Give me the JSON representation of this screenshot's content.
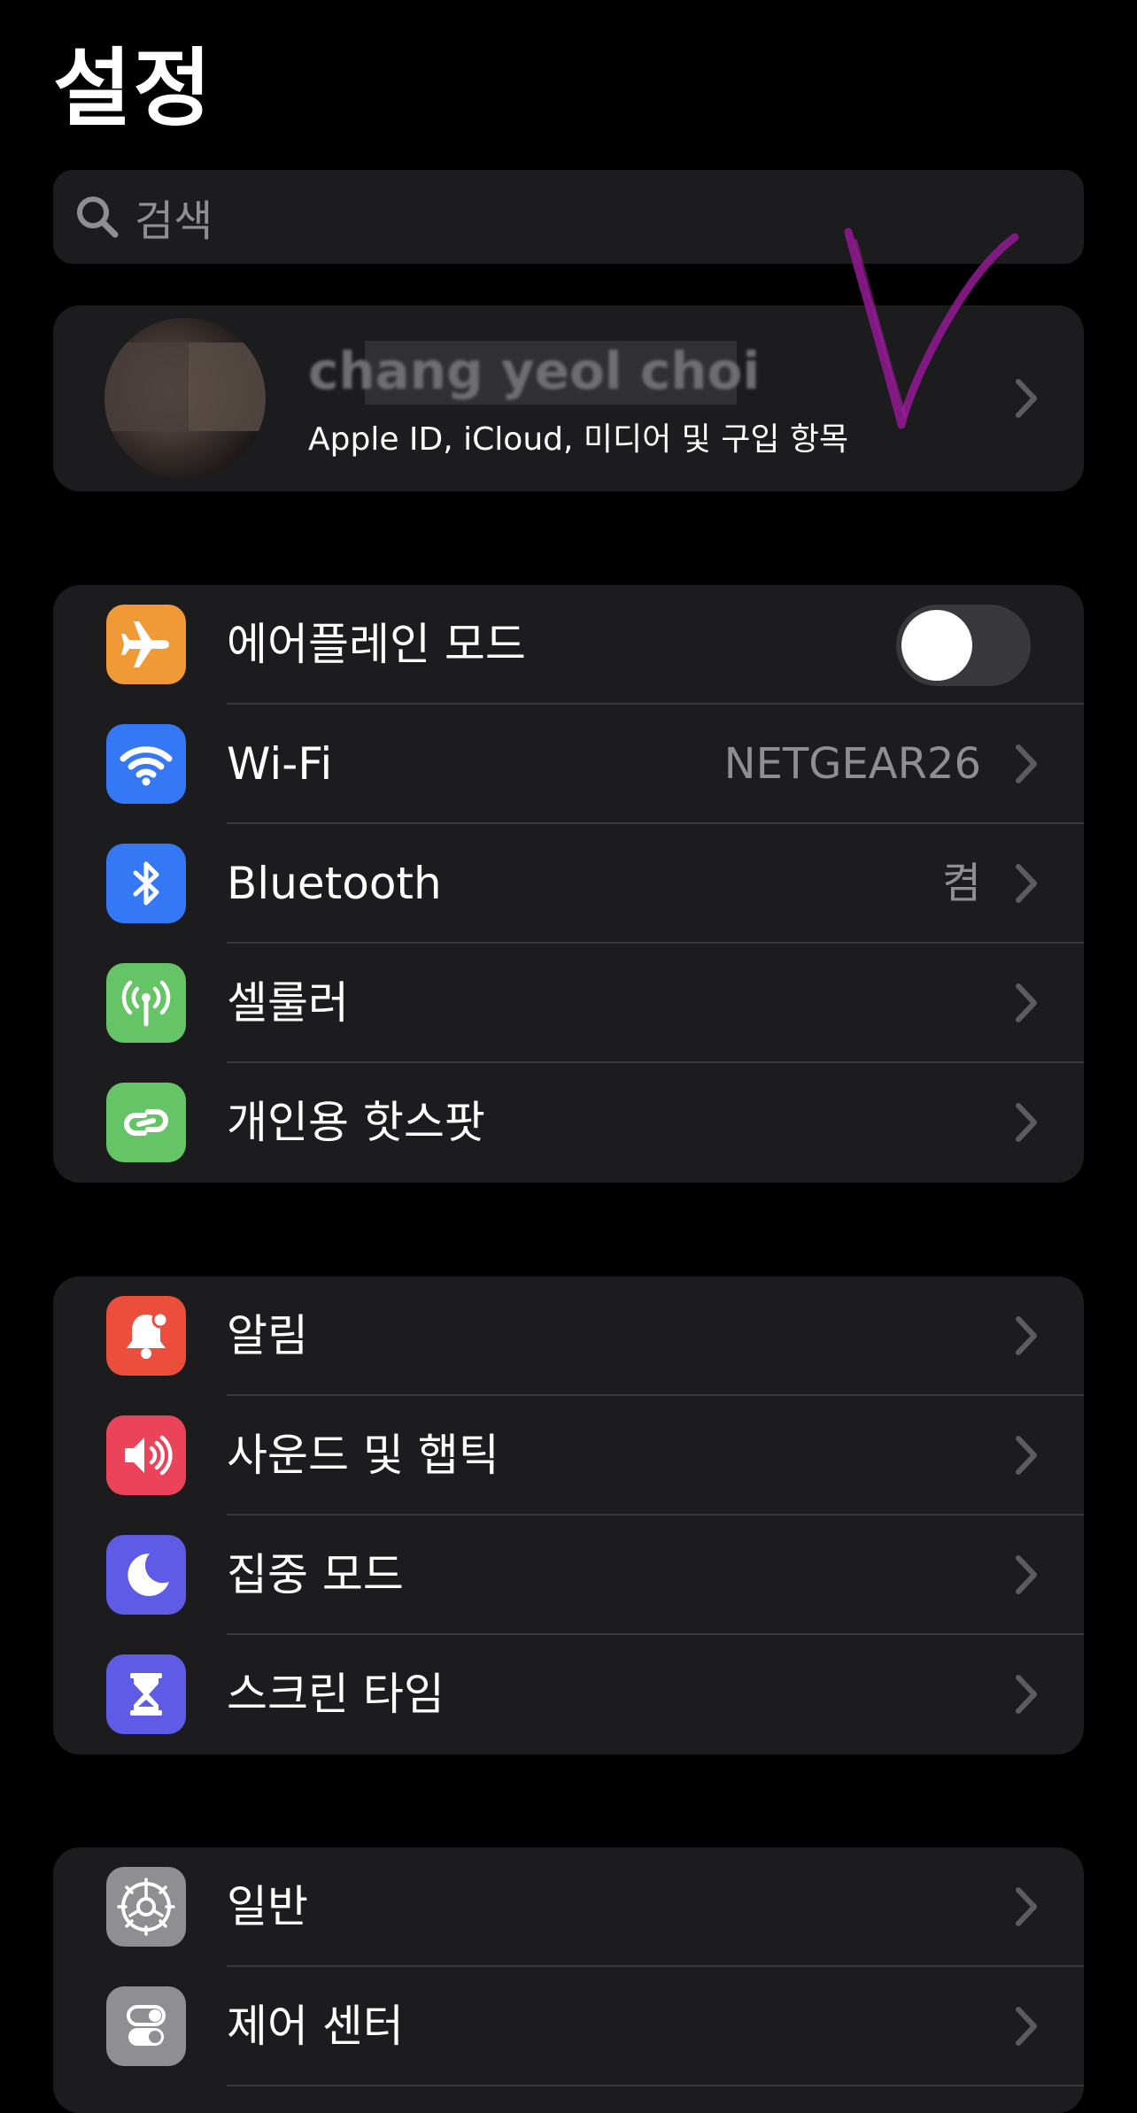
{
  "header": {
    "title": "설정"
  },
  "search": {
    "placeholder": "검색"
  },
  "profile": {
    "name": "chang yeol choi",
    "subtitle": "Apple ID, iCloud, 미디어 및 구입 항목"
  },
  "group1": {
    "items": [
      {
        "label": "에어플레인 모드",
        "icon": "airplane-icon",
        "color": "#f09a37",
        "toggle": false
      },
      {
        "label": "Wi-Fi",
        "icon": "wifi-icon",
        "color": "#3478f6",
        "value": "NETGEAR26"
      },
      {
        "label": "Bluetooth",
        "icon": "bluetooth-icon",
        "color": "#3478f6",
        "value": "켬"
      },
      {
        "label": "셀룰러",
        "icon": "antenna-icon",
        "color": "#65c466"
      },
      {
        "label": "개인용 핫스팟",
        "icon": "hotspot-link-icon",
        "color": "#65c466"
      }
    ]
  },
  "group2": {
    "items": [
      {
        "label": "알림",
        "icon": "bell-icon",
        "color": "#eb4e3d"
      },
      {
        "label": "사운드 및 햅틱",
        "icon": "speaker-icon",
        "color": "#eb445a"
      },
      {
        "label": "집중 모드",
        "icon": "moon-icon",
        "color": "#5e5ce6"
      },
      {
        "label": "스크린 타임",
        "icon": "hourglass-icon",
        "color": "#5e5ce6"
      }
    ]
  },
  "group3": {
    "items": [
      {
        "label": "일반",
        "icon": "gear-icon",
        "color": "#8e8e93"
      },
      {
        "label": "제어 센터",
        "icon": "switches-icon",
        "color": "#8e8e93"
      }
    ]
  },
  "colors": {
    "background": "#000000",
    "card": "#1c1c1e",
    "separator": "#38383a",
    "secondary_text": "#8e8e93",
    "scribble": "#8e1a8e"
  }
}
